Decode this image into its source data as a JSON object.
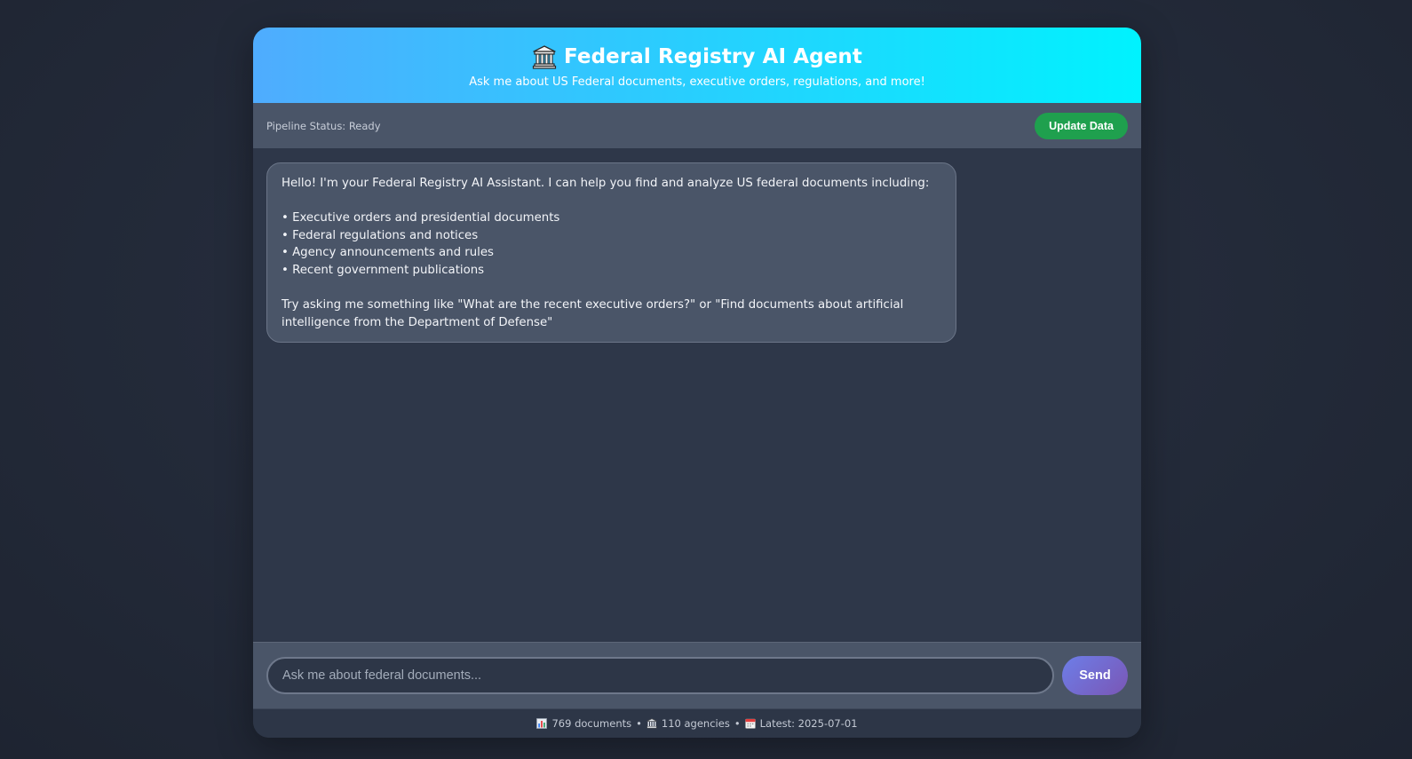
{
  "header": {
    "title": "Federal Registry AI Agent",
    "subtitle": "Ask me about US Federal documents, executive orders, regulations, and more!",
    "icon": "classical-building-icon"
  },
  "status": {
    "text": "Pipeline Status: Ready",
    "update_button_label": "Update Data"
  },
  "messages": [
    {
      "role": "assistant",
      "intro": "Hello! I'm your Federal Registry AI Assistant. I can help you find and analyze US federal documents including:",
      "items": [
        "• Executive orders and presidential documents",
        "• Federal regulations and notices",
        "• Agency announcements and rules",
        "• Recent government publications"
      ],
      "outro": "Try asking me something like \"What are the recent executive orders?\" or \"Find documents about artificial intelligence from the Department of Defense\""
    }
  ],
  "composer": {
    "placeholder": "Ask me about federal documents...",
    "value": "",
    "send_label": "Send"
  },
  "footer": {
    "documents": "769 documents",
    "agencies": "110 agencies",
    "latest": "Latest: 2025-07-01",
    "separator": "•"
  },
  "colors": {
    "header_gradient_start": "#4facfe",
    "header_gradient_end": "#00f2fe",
    "update_button": "#1fa04e",
    "send_gradient_start": "#6d7ee8",
    "send_gradient_end": "#7a56b5",
    "panel": "#4a5568",
    "chat_background": "#2e3749"
  }
}
